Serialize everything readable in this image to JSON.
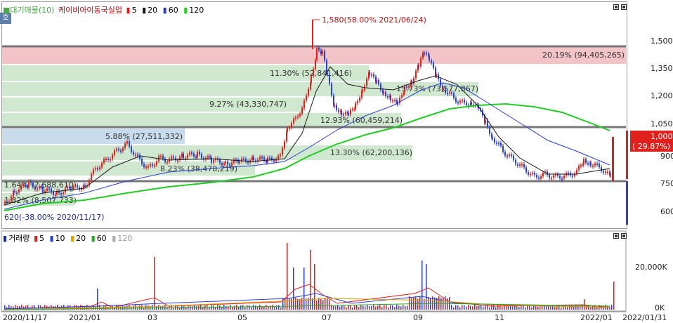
{
  "price_panel": {
    "legend": {
      "mode_label": "■대기매물(10)",
      "stock_name": "케이비아이동국실업",
      "ma": [
        {
          "label": "5",
          "color": "#e0201c"
        },
        {
          "label": "20",
          "color": "#1a1a1a"
        },
        {
          "label": "60",
          "color": "#2b3fd0"
        },
        {
          "label": "120",
          "color": "#22cc22"
        }
      ]
    },
    "side_tab_label": "호",
    "y_ticks": [
      "1,500",
      "1,350",
      "1,200",
      "1,050",
      "900",
      "750",
      "600"
    ],
    "current_price": "1,000",
    "current_change": "( 29.87%)",
    "high_annotation": "1,580(58.00% 2021/06/24)",
    "low_annotation": "620(-38.00% 2020/11/17)",
    "supply_bands": [
      "20.19% (94,405,265)",
      "11.30% (52,841,416)",
      "15.73% (73,577,867)",
      "9.27% (43,330,747)",
      "12.93% (60,459,214)",
      "5.88% (27,511,332)",
      "13.30% (62,200,136)",
      "8.23% (38,478,219)",
      "1.64% (7,688,610)",
      "1.82% (8,507,733)"
    ]
  },
  "volume_panel": {
    "legend": {
      "title": "거래량",
      "ma": [
        {
          "label": "5",
          "color": "#e0201c"
        },
        {
          "label": "10",
          "color": "#2b3fd0"
        },
        {
          "label": "20",
          "color": "#e0a000"
        },
        {
          "label": "60",
          "color": "#22aa22"
        },
        {
          "label": "120",
          "color": "#aaaaaa"
        }
      ]
    },
    "y_ticks": [
      "20,000K",
      "0K"
    ]
  },
  "x_axis": {
    "labels": [
      "2020/11/17",
      "2021/01",
      "03",
      "05",
      "07",
      "09",
      "11",
      "2022/01",
      "2022/01/31"
    ]
  },
  "colors": {
    "up": "#e0201c",
    "down": "#2b3fd0",
    "band_green": "#cfe8cf",
    "band_red": "#f2c4c8",
    "band_blue": "#c8dcec"
  }
}
